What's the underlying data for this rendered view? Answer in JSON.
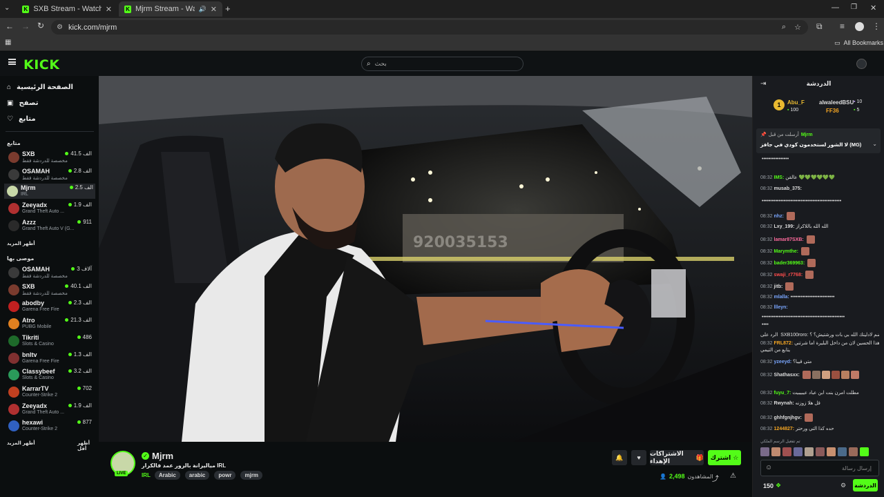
{
  "browser": {
    "tabs": [
      {
        "title": "SXB Stream - Watch Live on Kic"
      },
      {
        "title": "Mjrm Stream - Watch Live"
      }
    ],
    "url": "kick.com/mjrm",
    "bookmarks_label": "All Bookmarks"
  },
  "header": {
    "logo": "KICK",
    "search_placeholder": "بحث"
  },
  "sidebar": {
    "nav": [
      {
        "label": "الصفحة الرئيسية",
        "icon": "home-icon"
      },
      {
        "label": "تصفح",
        "icon": "browse-icon"
      },
      {
        "label": "متابع",
        "icon": "heart-icon"
      }
    ],
    "following_title": "متابع",
    "following": [
      {
        "name": "SXB",
        "category": "مخصصة للدردشة فقط",
        "viewers": "41.5 الف",
        "color": "#7a3b2e"
      },
      {
        "name": "OSAMAH",
        "category": "مخصصة للدردشة فقط",
        "viewers": "2.8 الف",
        "color": "#3a3a3a"
      },
      {
        "name": "Mjrm",
        "category": "IRL",
        "viewers": "2.5 الف",
        "color": "#c8d8a8"
      },
      {
        "name": "Zeeyadx",
        "category": "Grand Theft Auto ...",
        "viewers": "1.9 الف",
        "color": "#b03030"
      },
      {
        "name": "Azzz",
        "category": "Grand Theft Auto V (G...",
        "viewers": "911",
        "color": "#2a2a2a"
      }
    ],
    "show_more": "أظهر المزيد",
    "recommended_title": "موصى بها",
    "recommended": [
      {
        "name": "OSAMAH",
        "category": "مخصصة للدردشة فقط",
        "viewers": "3 آلاف",
        "color": "#3a3a3a"
      },
      {
        "name": "SXB",
        "category": "مخصصة للدردشة فقط",
        "viewers": "40.1 الف",
        "color": "#7a3b2e"
      },
      {
        "name": "abodby",
        "category": "Garena Free Fire",
        "viewers": "2.3 الف",
        "color": "#c02020"
      },
      {
        "name": "Atro",
        "category": "PUBG Mobile",
        "viewers": "21.3 الف",
        "color": "#e08020"
      },
      {
        "name": "Tikriti",
        "category": "Slots & Casino",
        "viewers": "486",
        "color": "#1e6a2a"
      },
      {
        "name": "bnltv",
        "category": "Garena Free Fire",
        "viewers": "1.3 الف",
        "color": "#803030"
      },
      {
        "name": "Classybeef",
        "category": "Slots & Casino",
        "viewers": "3.2 الف",
        "color": "#2a9a5a"
      },
      {
        "name": "KarrarTV",
        "category": "Counter-Strike 2",
        "viewers": "702",
        "color": "#c04020"
      },
      {
        "name": "Zeeyadx",
        "category": "Grand Theft Auto ...",
        "viewers": "1.9 الف",
        "color": "#b03030"
      },
      {
        "name": "hexawi",
        "category": "Counter-Strike 2",
        "viewers": "877",
        "color": "#3060c0"
      }
    ],
    "show_more_2": "أظهر المزيد",
    "show_less": "أظهر أقل"
  },
  "video": {
    "van_text": "920035153"
  },
  "stream_info": {
    "username": "Mjrm",
    "live_badge": "LIVE",
    "title": "مياليرانة بالرور عمد فالكرار IRL",
    "category": "IRL",
    "tags": [
      "Arabic",
      "arabic",
      "powr",
      "mjrm"
    ],
    "subscribe": "اشترك",
    "gift_subs": "الاشتراكات الإهداء",
    "viewers_label": "المشاهدون",
    "viewers": "2,498"
  },
  "chat": {
    "title": "الدردشة",
    "leaderboard": [
      {
        "name": "Abu_F",
        "count": "100"
      },
      {
        "name": "alwaleedBSU",
        "count": "10"
      },
      {
        "name": "FF36",
        "count": "5"
      }
    ],
    "pinned_by": "أرسلت من قبل",
    "pinned_user": "Mjrm",
    "pinned_text": "لا الشور لستخدمون كودي في جافز (MG)",
    "messages": [
      {
        "time": "",
        "user": "",
        "color": "#ddd",
        "text": "••••••••••••••••",
        "emotes": 0
      },
      {
        "time": "08:32",
        "user": "IMS:",
        "color": "#53fc18",
        "text": "عالقن 💚💚💚💚💚💚",
        "emotes": 0
      },
      {
        "time": "08:32",
        "user": "musab_375:",
        "color": "#ddd",
        "text": "",
        "emotes": 0
      },
      {
        "time": "",
        "user": "",
        "color": "#ddd",
        "text": "•••••••••••••••••••••••••••••••••••••••••••••••",
        "emotes": 0
      },
      {
        "time": "08:32",
        "user": "nhz:",
        "color": "#7aa7ff",
        "text": "",
        "emotes": 1
      },
      {
        "time": "08:32",
        "user": "Lxy_199:",
        "color": "#ddd",
        "text": "الله الله باللاكراز",
        "emotes": 0
      },
      {
        "time": "08:32",
        "user": "lamar87SXB:",
        "color": "#ff6b9d",
        "text": "",
        "emotes": 1
      },
      {
        "time": "08:32",
        "user": "Marymthe:",
        "color": "#53fc18",
        "text": "",
        "emotes": 1
      },
      {
        "time": "08:32",
        "user": "bader369963:",
        "color": "#53fc18",
        "text": "",
        "emotes": 1
      },
      {
        "time": "08:32",
        "user": "swaji_r7768:",
        "color": "#ff4d4d",
        "text": "",
        "emotes": 1
      },
      {
        "time": "08:32",
        "user": "jitb:",
        "color": "#ddd",
        "text": "",
        "emotes": 1
      },
      {
        "time": "08:32",
        "user": "mlalla:",
        "color": "#7aa7ff",
        "text": "••••••••••••••••••••••••••",
        "emotes": 0
      },
      {
        "time": "08:32",
        "user": "llleyn:",
        "color": "#7aa7ff",
        "text": "",
        "emotes": 0
      },
      {
        "time": "",
        "user": "",
        "color": "#ddd",
        "text": "•••••••••••••••••••••••••••••••••••••••••••••••••",
        "emotes": 0
      },
      {
        "time": "",
        "user": "",
        "color": "#ddd",
        "text": "••••",
        "emotes": 0
      },
      {
        "time": "",
        "user": "",
        "color": "#9aa0a6",
        "text": "الرد على SXB100roro: وانضم لادليتك الله بي بات ورشتيش؟ ؟",
        "emotes": 0
      },
      {
        "time": "08:32",
        "user": "FRL872:",
        "color": "#f5a623",
        "text": "هذا الحسين لان من داخل البليرة اما شرتني",
        "emotes": 0
      },
      {
        "time": "",
        "user": "",
        "color": "#ddd",
        "text": "يتابع من التيمي",
        "emotes": 0
      },
      {
        "time": "08:32",
        "user": "yzeeyd:",
        "color": "#7aa7ff",
        "text": "متى قيبا؟",
        "emotes": 0
      },
      {
        "time": "08:32",
        "user": "Shathasxx:",
        "color": "#ddd",
        "text": "",
        "emotes": 6
      },
      {
        "time": "08:32",
        "user": "fuyu_7:",
        "color": "#53fc18",
        "text": "مطلت امرن بنت ابن عباد عيبيبيت",
        "emotes": 0
      },
      {
        "time": "08:32",
        "user": "Rwynah:",
        "color": "#ddd",
        "text": "قل هلا زوزنه",
        "emotes": 0
      },
      {
        "time": "08:32",
        "user": "ghhfgnjhgv:",
        "color": "#ddd",
        "text": "",
        "emotes": 1
      },
      {
        "time": "08:32",
        "user": "1244827:",
        "color": "#f5a623",
        "text": "حده كذا التي ورحتر",
        "emotes": 0
      }
    ],
    "emote_hint": "تم تفعيل الرسم الملكي",
    "input_placeholder": "إرسال رسالة",
    "send_label": "الدردشة",
    "points": "150"
  }
}
